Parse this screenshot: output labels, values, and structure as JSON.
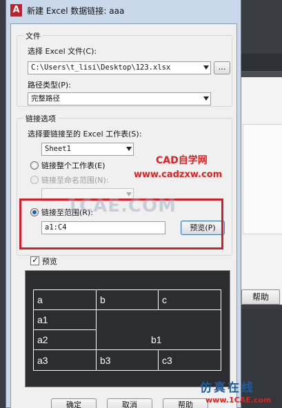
{
  "window": {
    "title": "新建 Excel 数据链接: aaa",
    "icon_letter": "A"
  },
  "file_group": {
    "title": "文件",
    "choose_label": "选择 Excel 文件(C):",
    "file_path": "C:\\Users\\t_lisi\\Desktop\\123.xlsx",
    "browse_label": "...",
    "path_type_label": "路径类型(P):",
    "path_type_value": "完整路径"
  },
  "link_group": {
    "title": "链接选项",
    "worksheet_label": "选择要链接至的 Excel 工作表(S):",
    "worksheet_value": "Sheet1",
    "link_entire_label": "链接整个工作表(E)",
    "link_named_range_label": "链接至命名范围(N):",
    "link_range_label": "链接至范围(R):",
    "range_value": "a1:C4",
    "preview_button": "预览(P)"
  },
  "preview_section": {
    "checkbox_label": "预览",
    "checked": true,
    "table": [
      [
        "a",
        "b",
        "c"
      ],
      [
        "a1",
        "b1",
        ""
      ],
      [
        "a2",
        "",
        ""
      ],
      [
        "a3",
        "b3",
        "c3"
      ]
    ]
  },
  "buttons": {
    "ok": "确定",
    "cancel": "取消",
    "help": "帮助"
  },
  "background_app": {
    "help_button": "帮助"
  },
  "watermarks": {
    "cad_title": "CAD自学网",
    "cad_url": "www.cadzxw.com",
    "faint": "1CAE.COM",
    "logo_main": "仿真在线",
    "logo_sub": "www.1CAE.com"
  },
  "colors": {
    "highlight": "#d0202a",
    "preview_bg": "#2b2d31",
    "accent": "#1f5fa8"
  },
  "icons": {
    "app": "autocad-app-icon",
    "close": "close-icon",
    "dropdown": "chevron-down-icon"
  }
}
